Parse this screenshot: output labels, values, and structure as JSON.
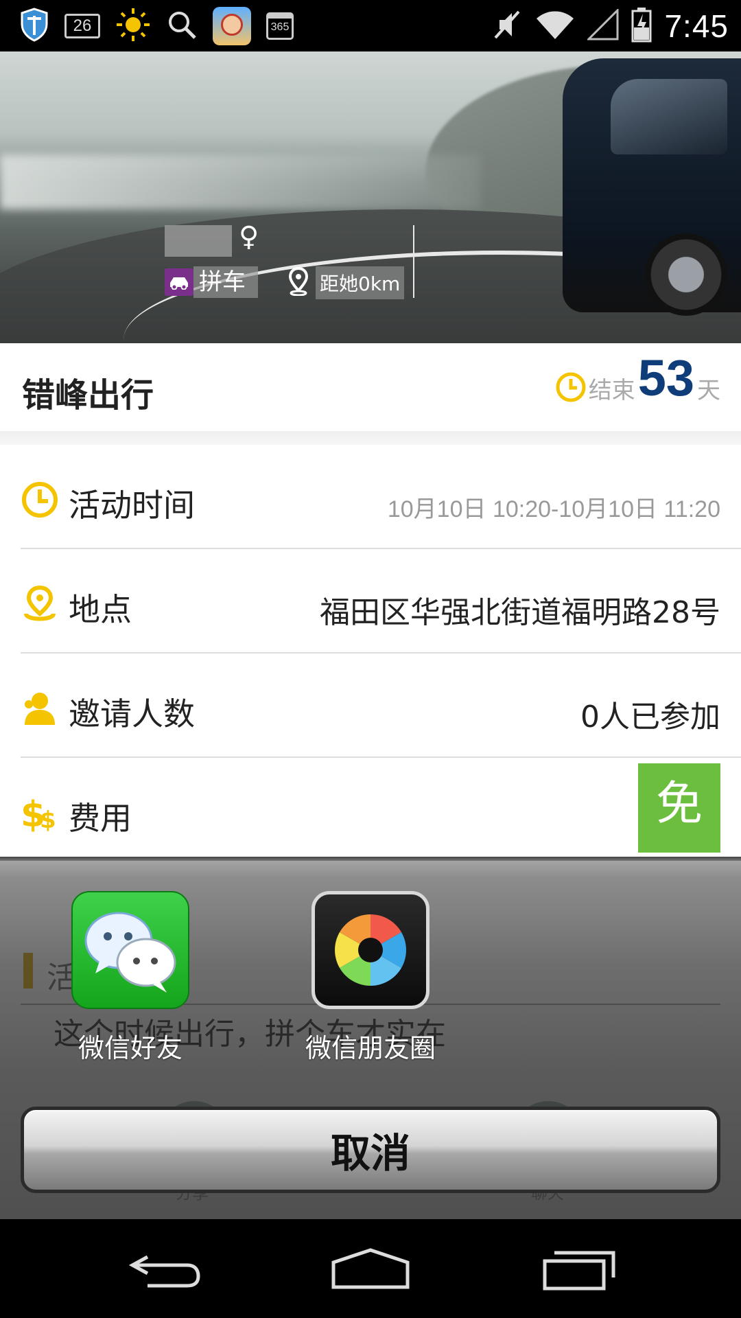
{
  "status_bar": {
    "time": "7:45",
    "notification_badge": "26",
    "calendar_badge": "365",
    "left_icons": [
      "shield-icon",
      "notification-count-icon",
      "sun-icon",
      "search-icon",
      "game-avatar-icon",
      "calendar-icon"
    ],
    "right_icons": [
      "mute-icon",
      "wifi-icon",
      "signal-icon",
      "battery-icon"
    ]
  },
  "banner": {
    "gender_symbol": "♀",
    "tag_label": "拼车",
    "distance": "距她0km"
  },
  "event": {
    "title": "错峰出行",
    "countdown_label": "结束",
    "countdown_days": "53",
    "countdown_unit": "天"
  },
  "details": {
    "time_label": "活动时间",
    "time_value": "10月10日 10:20-10月10日 11:20",
    "location_label": "地点",
    "location_value": "福田区华强北街道福明路28号",
    "invite_label": "邀请人数",
    "invite_value": "0人已参加",
    "fee_label": "费用",
    "fee_value": "免"
  },
  "background_content": {
    "section_title": "活",
    "description": "这个时候出行，拼个车才实在",
    "share_label": "分享",
    "chat_label": "聊天"
  },
  "share_sheet": {
    "options": [
      {
        "label": "微信好友",
        "icon": "wechat-icon"
      },
      {
        "label": "微信朋友圈",
        "icon": "moments-icon"
      }
    ],
    "cancel_label": "取消"
  },
  "colors": {
    "accent_yellow": "#f5c400",
    "countdown_blue": "#0f3d7a",
    "free_green": "#6cbf3e",
    "carpool_purple": "#7a2f8a"
  }
}
